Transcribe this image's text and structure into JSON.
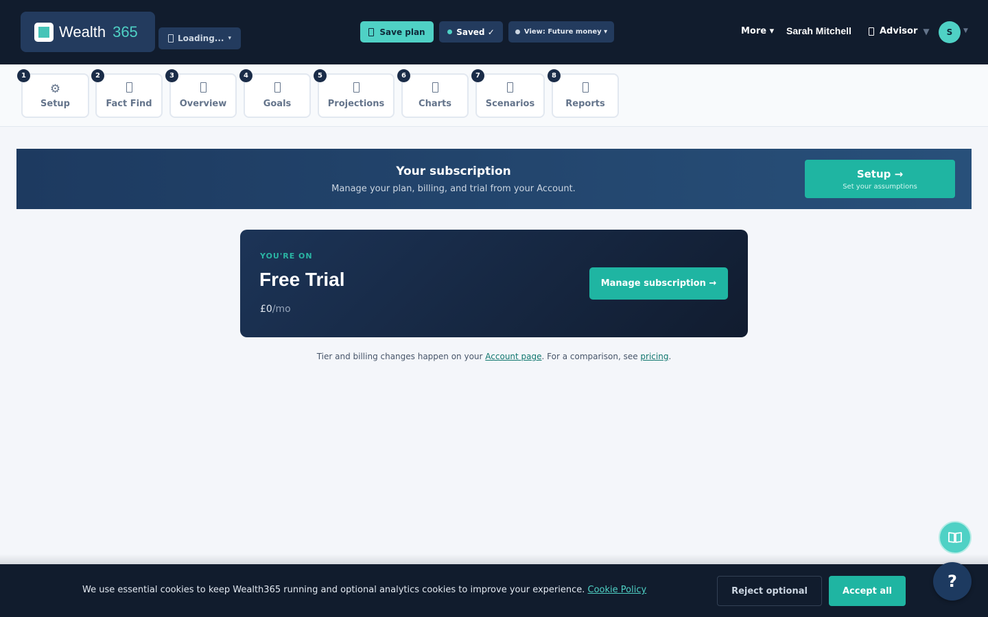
{
  "header": {
    "logo_text": "Wealth",
    "logo_number": "365",
    "loading_label": "Loading...",
    "loading_caret": "▾",
    "save_plan_label": "Save plan",
    "saved_label": "Saved ✓",
    "view_label": "View: Future money ▾",
    "more_label": "More ▾",
    "user_name": "Sarah Mitchell",
    "role_label": "Advisor",
    "role_caret": "▼",
    "avatar_initial": "S",
    "avatar_caret": "▼"
  },
  "steps": [
    {
      "num": "1",
      "label": "Setup",
      "icon": "gear-icon",
      "glyph": "⚙"
    },
    {
      "num": "2",
      "label": "Fact Find",
      "icon": "fact-find-icon"
    },
    {
      "num": "3",
      "label": "Overview",
      "icon": "overview-icon"
    },
    {
      "num": "4",
      "label": "Goals",
      "icon": "goals-icon"
    },
    {
      "num": "5",
      "label": "Projections",
      "icon": "projections-icon"
    },
    {
      "num": "6",
      "label": "Charts",
      "icon": "charts-icon"
    },
    {
      "num": "7",
      "label": "Scenarios",
      "icon": "scenarios-icon"
    },
    {
      "num": "8",
      "label": "Reports",
      "icon": "reports-icon"
    }
  ],
  "banner": {
    "title": "Your subscription",
    "subtitle": "Manage your plan, billing, and trial from your Account.",
    "cta_title": "Setup →",
    "cta_subtitle": "Set your assumptions"
  },
  "plan": {
    "eyebrow": "YOU'RE ON",
    "name": "Free Trial",
    "price": "£0",
    "period": "/mo",
    "manage_label": "Manage subscription →"
  },
  "note": {
    "prefix": "Tier and billing changes happen on your ",
    "account_link": "Account page",
    "middle": ". For a comparison, see ",
    "pricing_link": "pricing",
    "suffix": "."
  },
  "floating": {
    "help_label": "?",
    "book_icon": "book-icon"
  },
  "cookie": {
    "text": "We use essential cookies to keep Wealth365 running and optional analytics cookies to improve your experience.",
    "policy_link": "Cookie Policy",
    "reject_label": "Reject optional",
    "accept_label": "Accept all"
  },
  "colors": {
    "header_bg": "#111c2d",
    "accent": "#4fd1c5",
    "accent_dark": "#1fb5a2",
    "navy": "#1d3a60"
  }
}
